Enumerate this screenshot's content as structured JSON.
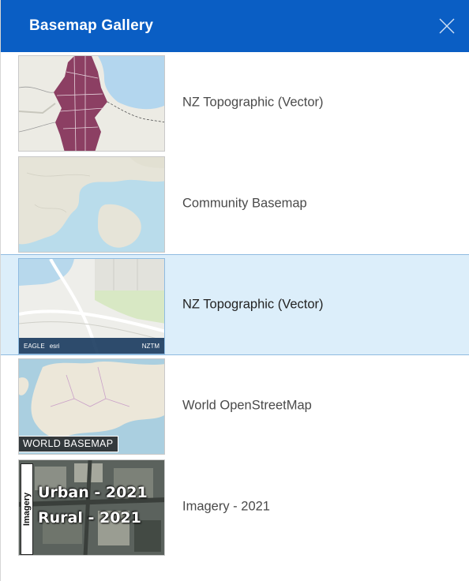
{
  "header": {
    "title": "Basemap Gallery",
    "close_icon": "close-icon",
    "background": "#0a5ec4"
  },
  "basemaps": [
    {
      "label": "NZ Topographic (Vector)",
      "selected": false
    },
    {
      "label": "Community Basemap",
      "selected": false
    },
    {
      "label": "NZ Topographic (Vector)",
      "selected": true,
      "thumbnail_logos": [
        "EAGLE",
        "esri",
        "NZTM"
      ]
    },
    {
      "label": "World OpenStreetMap",
      "selected": false,
      "thumbnail_text": "WORLD BASEMAP"
    },
    {
      "label": "Imagery - 2021",
      "selected": false,
      "thumbnail_side_text": "Imagery",
      "thumbnail_lines": [
        "Urban - 2021",
        "Rural - 2021"
      ]
    }
  ],
  "colors": {
    "selected_background": "#dceefa",
    "selected_border": "#8fbbe0"
  }
}
